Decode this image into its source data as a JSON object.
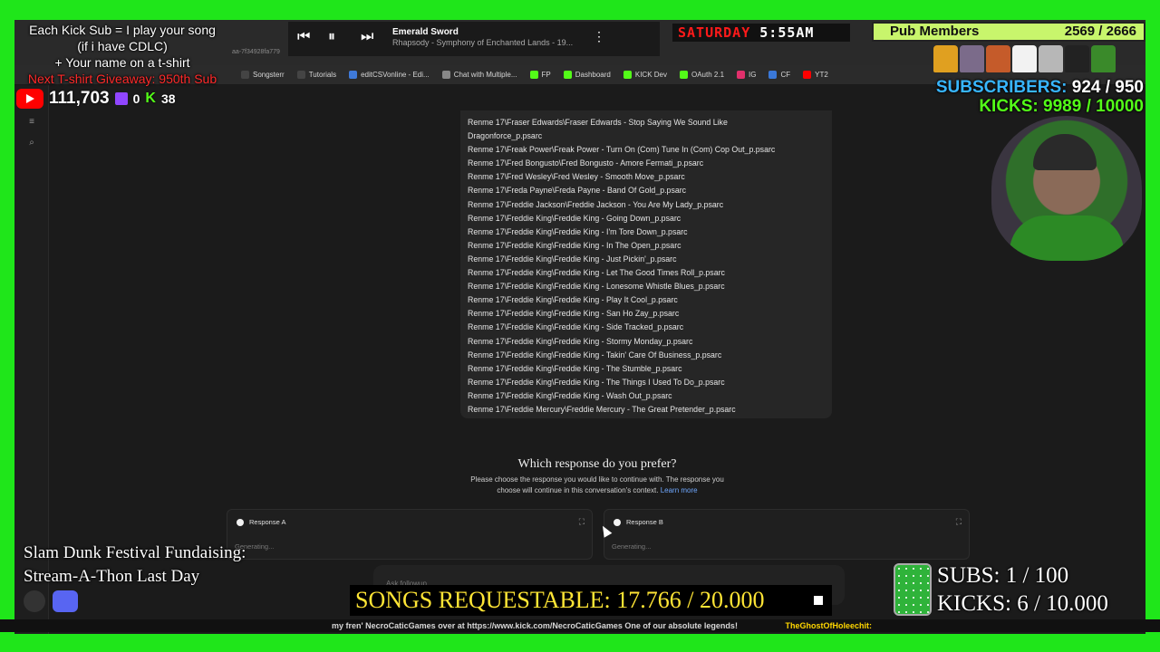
{
  "overlay": {
    "kick_sub_line1": "Each Kick Sub = I play your song",
    "kick_sub_line2": "(if i have CDLC)",
    "kick_sub_line3": "+ Your name on a t-shirt",
    "kick_sub_line4": "Next T-shirt Giveaway: 950th Sub",
    "youtube_views": "111,703",
    "twitch_viewers": "0",
    "kick_viewers": "38",
    "clock_day": "SATURDAY",
    "clock_time": "5:55AM",
    "pub_label": "Pub Members",
    "pub_count": "2569 / 2666",
    "subscribers_label": "SUBSCRIBERS:",
    "subscribers_value": "924 / 950",
    "kicks_label": "KICKS:",
    "kicks_value": "9989 / 10000",
    "fundraiser_line1": "Slam Dunk Festival Fundaising:",
    "fundraiser_line2": "Stream-A-Thon Last Day",
    "songs_requestable": "SONGS REQUESTABLE: 17.766 / 20.000",
    "ticker_text": "my fren' NecroCaticGames over at https://www.kick.com/NecroCaticGames One of our absolute legends!",
    "ticker_name": "TheGhostOfHoleechit:",
    "subs_bottom_label": "SUBS:",
    "subs_bottom_value": "1 / 100",
    "kicks_bottom_label": "KICKS:",
    "kicks_bottom_value": "6 / 10.000",
    "accent_green": "#1fe61a",
    "kick_green": "#53fc18"
  },
  "player": {
    "title": "Emerald Sword",
    "subtitle": "Rhapsody - Symphony of Enchanted Lands - 19..."
  },
  "browser": {
    "url_fragment": "aa-7f34928fa779",
    "bookmarks": [
      "Songsterr",
      "Tutorials",
      "editCSVonline - Edi...",
      "Chat with Multiple...",
      "FP",
      "Dashboard",
      "KICK Dev",
      "OAuth 2.1",
      "IG",
      "CF",
      "YT2"
    ]
  },
  "files": [
    "Renme 17\\Fraser Edwards\\Fraser Edwards - Stop Saying We Sound Like",
    "Dragonforce_p.psarc",
    "Renme 17\\Freak Power\\Freak Power - Turn On (Com) Tune In (Com) Cop Out_p.psarc",
    "Renme 17\\Fred Bongusto\\Fred Bongusto - Amore Fermati_p.psarc",
    "Renme 17\\Fred Wesley\\Fred Wesley - Smooth Move_p.psarc",
    "Renme 17\\Freda Payne\\Freda Payne - Band Of Gold_p.psarc",
    "Renme 17\\Freddie Jackson\\Freddie Jackson - You Are My Lady_p.psarc",
    "Renme 17\\Freddie King\\Freddie King - Going Down_p.psarc",
    "Renme 17\\Freddie King\\Freddie King - I'm Tore Down_p.psarc",
    "Renme 17\\Freddie King\\Freddie King - In The Open_p.psarc",
    "Renme 17\\Freddie King\\Freddie King - Just Pickin'_p.psarc",
    "Renme 17\\Freddie King\\Freddie King - Let The Good Times Roll_p.psarc",
    "Renme 17\\Freddie King\\Freddie King - Lonesome Whistle Blues_p.psarc",
    "Renme 17\\Freddie King\\Freddie King - Play It Cool_p.psarc",
    "Renme 17\\Freddie King\\Freddie King - San Ho Zay_p.psarc",
    "Renme 17\\Freddie King\\Freddie King - Side Tracked_p.psarc",
    "Renme 17\\Freddie King\\Freddie King - Stormy Monday_p.psarc",
    "Renme 17\\Freddie King\\Freddie King - Takin' Care Of Business_p.psarc",
    "Renme 17\\Freddie King\\Freddie King - The Stumble_p.psarc",
    "Renme 17\\Freddie King\\Freddie King - The Things I Used To Do_p.psarc",
    "Renme 17\\Freddie King\\Freddie King - Wash Out_p.psarc",
    "Renme 17\\Freddie Mercury\\Freddie Mercury - The Great Pretender_p.psarc"
  ],
  "prefer": {
    "heading": "Which response do you prefer?",
    "desc1": "Please choose the response you would like to continue with. The response you",
    "desc2": "choose will continue in this conversation's context.",
    "learn_more": "Learn more"
  },
  "responses": {
    "a_label": "Response A",
    "b_label": "Response B",
    "a_status": "Generating...",
    "b_status": "Generating..."
  },
  "ask": {
    "placeholder": "Ask followup..."
  }
}
